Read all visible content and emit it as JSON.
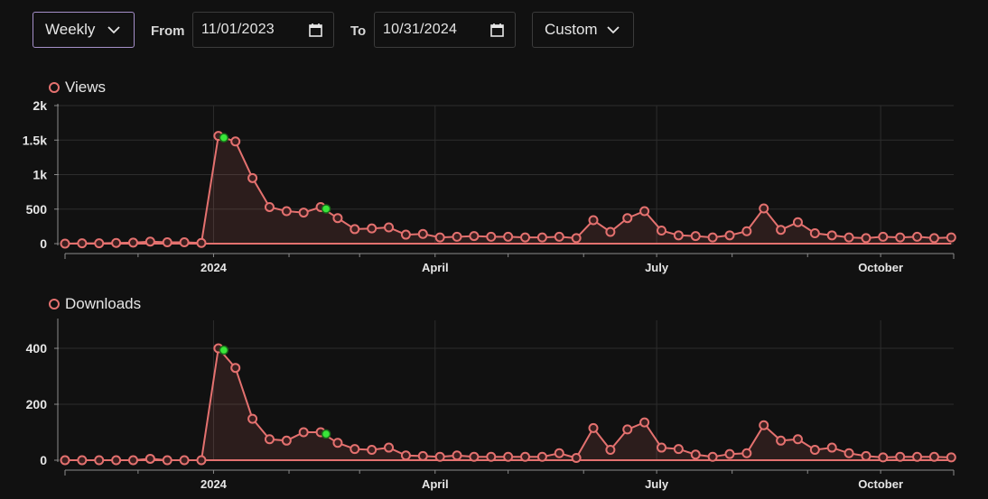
{
  "toolbar": {
    "period_select": "Weekly",
    "from_label": "From",
    "from_value": "11/01/2023",
    "to_label": "To",
    "to_value": "10/31/2024",
    "range_select": "Custom"
  },
  "colors": {
    "line": "#e4716f",
    "marker_fill": "#3a1f1f",
    "highlight": "#39e639",
    "grid": "#2d2d2d",
    "axis": "#8a8a8a",
    "background": "#111111"
  },
  "chart_data": [
    {
      "type": "area",
      "title": "",
      "legend": "Views",
      "legend_position": "top-left",
      "grid": true,
      "ylim": [
        0,
        2000
      ],
      "y_ticks": [
        0,
        500,
        1000,
        1500,
        2000
      ],
      "y_tick_labels": [
        "0",
        "500",
        "1k",
        "1.5k",
        "2k"
      ],
      "x_tick_labels": [
        "2024",
        "April",
        "July",
        "October"
      ],
      "xlim": [
        "2023-11-01",
        "2024-10-31"
      ],
      "series": [
        {
          "name": "Views",
          "x": [
            "2023-11-01",
            "2023-11-08",
            "2023-11-15",
            "2023-11-22",
            "2023-11-29",
            "2023-12-06",
            "2023-12-13",
            "2023-12-20",
            "2023-12-27",
            "2024-01-03",
            "2024-01-10",
            "2024-01-17",
            "2024-01-24",
            "2024-01-31",
            "2024-02-07",
            "2024-02-14",
            "2024-02-21",
            "2024-02-28",
            "2024-03-06",
            "2024-03-13",
            "2024-03-20",
            "2024-03-27",
            "2024-04-03",
            "2024-04-10",
            "2024-04-17",
            "2024-04-24",
            "2024-05-01",
            "2024-05-08",
            "2024-05-15",
            "2024-05-22",
            "2024-05-29",
            "2024-06-05",
            "2024-06-12",
            "2024-06-19",
            "2024-06-26",
            "2024-07-03",
            "2024-07-10",
            "2024-07-17",
            "2024-07-24",
            "2024-07-31",
            "2024-08-07",
            "2024-08-14",
            "2024-08-21",
            "2024-08-28",
            "2024-09-04",
            "2024-09-11",
            "2024-09-18",
            "2024-09-25",
            "2024-10-02",
            "2024-10-09",
            "2024-10-16",
            "2024-10-23",
            "2024-10-30"
          ],
          "values": [
            0,
            5,
            5,
            10,
            15,
            30,
            20,
            20,
            10,
            1560,
            1480,
            950,
            530,
            470,
            450,
            530,
            370,
            210,
            220,
            235,
            130,
            140,
            90,
            100,
            110,
            100,
            100,
            90,
            90,
            100,
            80,
            340,
            170,
            370,
            470,
            190,
            120,
            110,
            90,
            120,
            180,
            510,
            200,
            310,
            150,
            120,
            90,
            80,
            100,
            90,
            100,
            80,
            90
          ],
          "highlight_indices": [
            9,
            15
          ]
        }
      ]
    },
    {
      "type": "area",
      "title": "",
      "legend": "Downloads",
      "legend_position": "top-left",
      "grid": true,
      "ylim": [
        0,
        500
      ],
      "y_ticks": [
        0,
        200,
        400
      ],
      "y_tick_labels": [
        "0",
        "200",
        "400"
      ],
      "x_tick_labels": [
        "2024",
        "April",
        "July",
        "October"
      ],
      "xlim": [
        "2023-11-01",
        "2024-10-31"
      ],
      "series": [
        {
          "name": "Downloads",
          "x": [
            "2023-11-01",
            "2023-11-08",
            "2023-11-15",
            "2023-11-22",
            "2023-11-29",
            "2023-12-06",
            "2023-12-13",
            "2023-12-20",
            "2023-12-27",
            "2024-01-03",
            "2024-01-10",
            "2024-01-17",
            "2024-01-24",
            "2024-01-31",
            "2024-02-07",
            "2024-02-14",
            "2024-02-21",
            "2024-02-28",
            "2024-03-06",
            "2024-03-13",
            "2024-03-20",
            "2024-03-27",
            "2024-04-03",
            "2024-04-10",
            "2024-04-17",
            "2024-04-24",
            "2024-05-01",
            "2024-05-08",
            "2024-05-15",
            "2024-05-22",
            "2024-05-29",
            "2024-06-05",
            "2024-06-12",
            "2024-06-19",
            "2024-06-26",
            "2024-07-03",
            "2024-07-10",
            "2024-07-17",
            "2024-07-24",
            "2024-07-31",
            "2024-08-07",
            "2024-08-14",
            "2024-08-21",
            "2024-08-28",
            "2024-09-04",
            "2024-09-11",
            "2024-09-18",
            "2024-09-25",
            "2024-10-02",
            "2024-10-09",
            "2024-10-16",
            "2024-10-23",
            "2024-10-30"
          ],
          "values": [
            0,
            0,
            0,
            0,
            0,
            5,
            0,
            0,
            0,
            400,
            330,
            148,
            75,
            70,
            100,
            100,
            62,
            40,
            37,
            45,
            17,
            15,
            12,
            17,
            12,
            12,
            12,
            12,
            12,
            25,
            8,
            115,
            37,
            110,
            135,
            45,
            40,
            20,
            12,
            22,
            25,
            125,
            70,
            75,
            37,
            45,
            25,
            15,
            10,
            12,
            12,
            12,
            10
          ],
          "highlight_indices": [
            9,
            15
          ]
        }
      ]
    }
  ]
}
